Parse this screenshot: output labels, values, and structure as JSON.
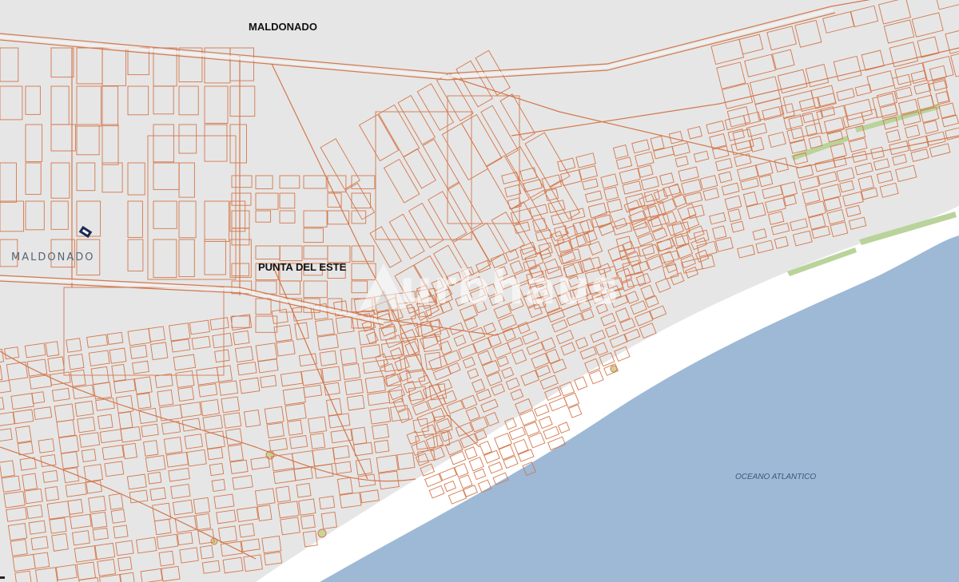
{
  "map": {
    "labels": {
      "city_top": "MALDONADO",
      "city_left": "MALDONADO",
      "city_center": "PUNTA DEL ESTE",
      "ocean": "OCEANO ATLANTICO"
    },
    "watermark": "urbhaus",
    "colors": {
      "land": "#e6e6e6",
      "parcel_lines": "#d4784c",
      "road_fill": "#f5f5f5",
      "beach": "#ffffff",
      "ocean": "#9db9d6",
      "green_strip": "#b9d39a",
      "roundabout": "#c9d49a",
      "marker": "#1c2a55"
    },
    "icons": {
      "property_marker": "property-marker-icon",
      "watermark_logo": "house-logo-icon"
    }
  }
}
